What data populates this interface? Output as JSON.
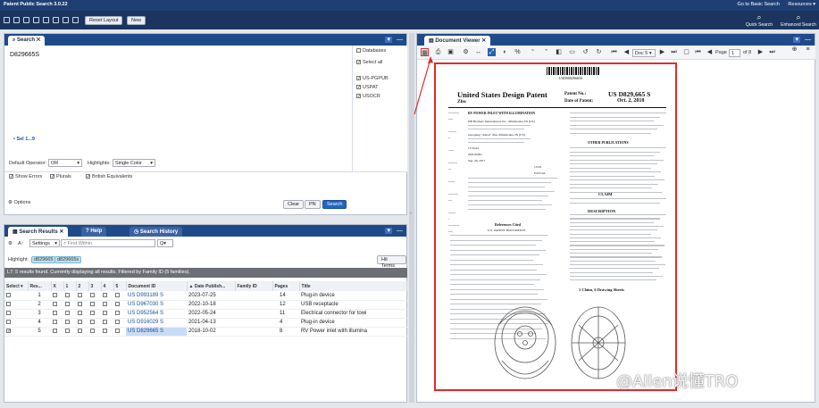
{
  "app": {
    "title": "Patent Public Search 3.0.22",
    "goto_basic": "Go to Basic Search",
    "resources": "Resources ▾"
  },
  "toolbar": {
    "reset_layout": "Reset Layout",
    "new": "New",
    "quick_search": "Quick Search",
    "enhanced_search": "Enhanced Search"
  },
  "search": {
    "tab": "Search",
    "query": "D829665S",
    "sel_link": "• Sel 1...9",
    "databases_label": "Databases",
    "select_all": "Select all",
    "databases": [
      "US-PGPUB",
      "USPAT",
      "USOCR"
    ],
    "default_operator_label": "Default Operator:",
    "default_operator": "OR",
    "highlights_label": "Highlights:",
    "highlights": "Single Color",
    "show_errors": "Show Errors",
    "plurals": "Plurals",
    "british": "British Equivalents",
    "options": "Options",
    "clear": "Clear",
    "pn": "PN",
    "search_btn": "Search"
  },
  "results": {
    "tabs": [
      "Search Results",
      "Help",
      "Search History"
    ],
    "settings": "Settings",
    "find_placeholder": "Find Within",
    "highlight_label": "Highlight:",
    "highlight_chips": [
      "d829665",
      "d829665s"
    ],
    "hit_terms": "Hit Terms",
    "status": "L7: 5 results found. Currently displaying all results. Filtered by Family ID (5 families).",
    "columns": [
      "Select",
      "Res...",
      "X",
      "1",
      "2",
      "3",
      "4",
      "5",
      "Document ID",
      "Date Publish...",
      "Family ID",
      "Pages",
      "Title"
    ],
    "rows": [
      {
        "res": "1",
        "doc": "US D993189 S",
        "date": "2023-07-25",
        "family": "",
        "pages": "14",
        "title": "Plug-in device",
        "checked": false
      },
      {
        "res": "2",
        "doc": "US D967030 S",
        "date": "2022-10-18",
        "family": "",
        "pages": "12",
        "title": "USB receptacle",
        "checked": false
      },
      {
        "res": "3",
        "doc": "US D952564 S",
        "date": "2022-05-24",
        "family": "",
        "pages": "11",
        "title": "Electrical connector for towi",
        "checked": false
      },
      {
        "res": "4",
        "doc": "US D916029 S",
        "date": "2021-04-13",
        "family": "",
        "pages": "4",
        "title": "Plug-in device",
        "checked": false
      },
      {
        "res": "5",
        "doc": "US D829665 S",
        "date": "2018-10-02",
        "family": "",
        "pages": "8",
        "title": "RV Power inlet with illumina",
        "checked": true
      }
    ]
  },
  "viewer": {
    "tab": "Document Viewer",
    "doc_select": "Doc 5",
    "page_label": "Page",
    "page_num": "1",
    "page_of": "of 8",
    "patent": {
      "barcode_text": "USD00829665S",
      "title_line": "United States Design Patent",
      "patent_no_label": "Patent No.:",
      "patent_no": "US D829,665 S",
      "inventor": "Zhu",
      "date_label": "Date of Patent:",
      "date": "Oct. 2, 2018",
      "item54": "RV POWER INLET WITH ILLUMINATION",
      "applicant": "JIB Brothers International, Inc., Mishawaka, IN (US)",
      "inventor_full": "Guoqiang \"Anton\" Zhu, Mishawaka, IN (US)",
      "term": "15 Years",
      "appl_no": "29/618,991",
      "filed": "Sep. 26, 2017",
      "loc": "13-03",
      "uscl": "D13/144",
      "other_pub": "OTHER PUBLICATIONS",
      "claim": "CLAIM",
      "description": "DESCRIPTION",
      "claims_sheets": "1 Claim, 6 Drawing Sheets",
      "ref_cited": "References Cited",
      "us_docs": "U.S. PATENT DOCUMENTS"
    }
  },
  "watermark": "@Allen说懂TRO"
}
